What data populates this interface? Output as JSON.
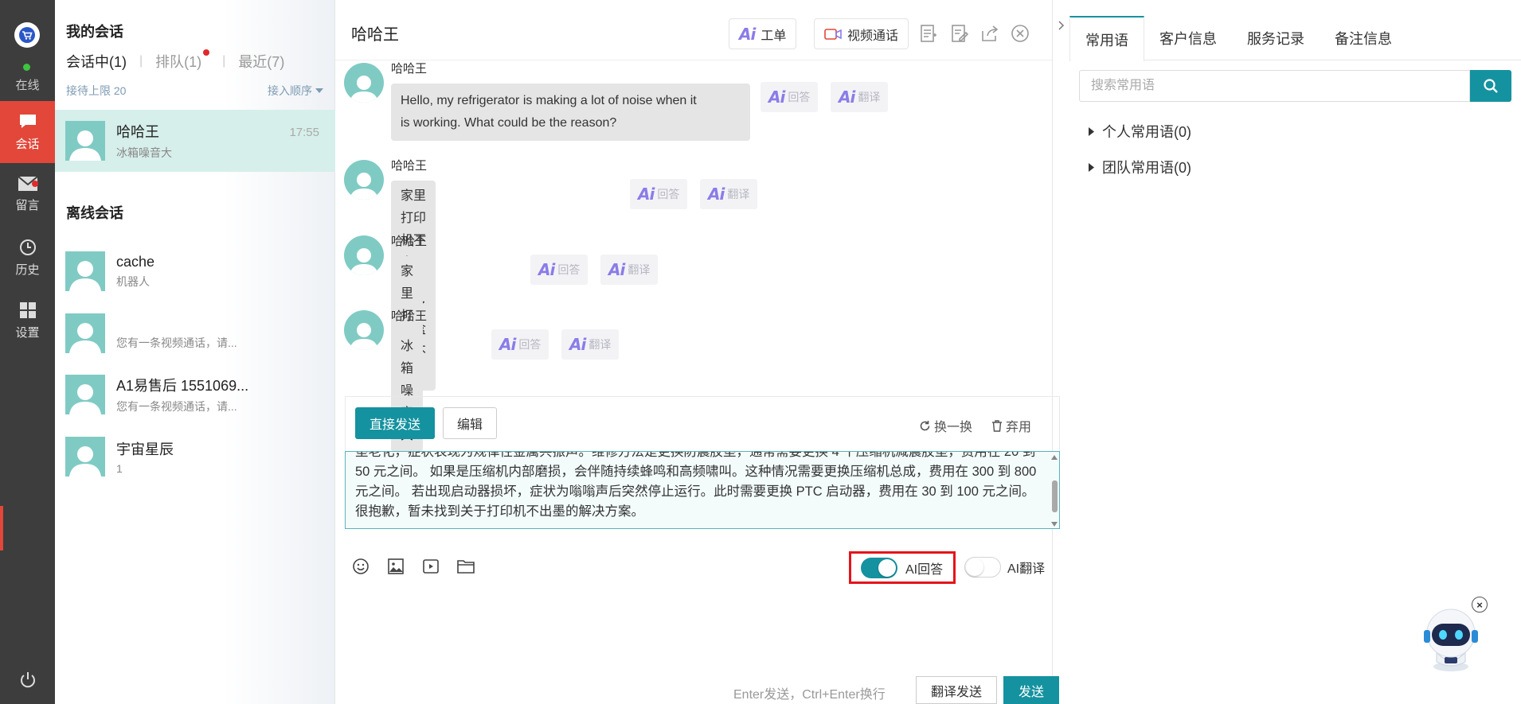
{
  "rail": {
    "status": "在线",
    "items": [
      {
        "label": "会话",
        "icon": "chat-bubble-icon"
      },
      {
        "label": "留言",
        "icon": "envelope-icon"
      },
      {
        "label": "历史",
        "icon": "clock-icon"
      },
      {
        "label": "设置",
        "icon": "grid-icon"
      }
    ],
    "logo_icon": "shopping-cart-logo-icon",
    "power_icon": "power-icon"
  },
  "sessions": {
    "title": "我的会话",
    "tabs": [
      {
        "label": "会话中(1)"
      },
      {
        "label": "排队(1)"
      },
      {
        "label": "最近(7)"
      }
    ],
    "limit": "接待上限 20",
    "order": "接入顺序",
    "active": [
      {
        "name": "哈哈王",
        "msg": "冰箱噪音大",
        "time": "17:55"
      }
    ],
    "offline_title": "离线会话",
    "offline": [
      {
        "name": "cache",
        "msg": "机器人"
      },
      {
        "name": "",
        "msg": "您有一条视频通话，请..."
      },
      {
        "name": "A1易售后 1551069...",
        "msg": "您有一条视频通话，请..."
      },
      {
        "name": "宇宙星辰",
        "msg": "1"
      }
    ]
  },
  "chat": {
    "title": "哈哈王",
    "header_buttons": {
      "ticket": "工单",
      "video": "视频通话"
    },
    "header_icons": [
      "notes-icon",
      "edit-icon",
      "share-icon",
      "close-circle-icon"
    ],
    "messages": [
      {
        "sender": "哈哈王",
        "text_line1": "Hello, my refrigerator is making a lot of noise when it",
        "text_line2": "is working. What could be the reason?"
      },
      {
        "sender": "哈哈王",
        "text": "家里打印机不出墨，换了墨盒也不行"
      },
      {
        "sender": "哈哈王",
        "text": "家里打印机不出墨"
      },
      {
        "sender": "哈哈王",
        "text": "冰箱噪音大"
      }
    ],
    "ai_answer": "回答",
    "ai_translate": "翻译",
    "ai_logo": "Ai",
    "suggest": {
      "send_direct": "直接发送",
      "edit": "编辑",
      "refresh": "换一换",
      "discard": "弃用",
      "text": "垫老化，症状表现为规律性金属共振声。维修方法是更换防震胶垫，通常需要更换 4 个压缩机减震胶垫，费用在 20 到 50 元之间。 如果是压缩机内部磨损，会伴随持续蜂鸣和高频啸叫。这种情况需要更换压缩机总成，费用在 300 到 800 元之间。 若出现启动器损坏，症状为嗡嗡声后突然停止运行。此时需要更换 PTC 启动器，费用在 30 到 100 元之间。 很抱歉，暂未找到关于打印机不出墨的解决方案。"
    },
    "toolbar_icons": [
      "emoji-icon",
      "image-icon",
      "video-file-icon",
      "folder-icon"
    ],
    "ai_reply_toggle": {
      "label": "AI回答",
      "on": true
    },
    "ai_translate_toggle": {
      "label": "AI翻译",
      "on": false
    },
    "send_hint": "Enter发送，Ctrl+Enter换行",
    "translate_send": "翻译发送",
    "send": "发送"
  },
  "right": {
    "tabs": [
      {
        "label": "常用语",
        "active": true
      },
      {
        "label": "客户信息"
      },
      {
        "label": "服务记录"
      },
      {
        "label": "备注信息"
      }
    ],
    "search_placeholder": "搜索常用语",
    "folders": [
      {
        "label": "个人常用语(0)"
      },
      {
        "label": "团队常用语(0)"
      }
    ],
    "robot_close": "×"
  },
  "colors": {
    "teal": "#15929f",
    "red": "#e2473a",
    "rail": "#3d3d3d",
    "highlight_border": "#e5141b"
  }
}
